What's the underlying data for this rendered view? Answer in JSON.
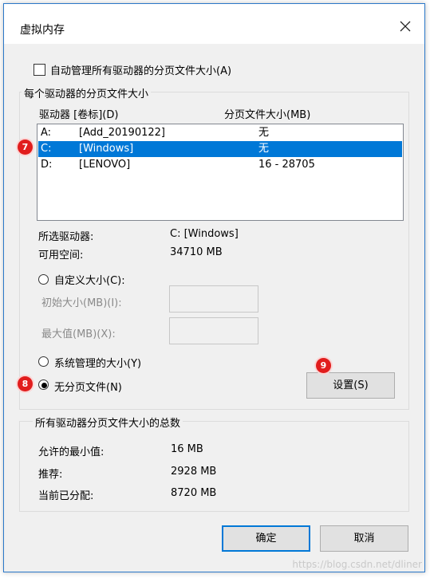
{
  "window": {
    "title": "虚拟内存",
    "close_icon": "close-icon"
  },
  "auto_manage": {
    "label": "自动管理所有驱动器的分页文件大小(A)",
    "checked": false
  },
  "per_drive": {
    "group_title": "每个驱动器的分页文件大小",
    "col_drive": "驱动器 [卷标](D)",
    "col_size": "分页文件大小(MB)",
    "drives": [
      {
        "letter": "A:",
        "label": "[Add_20190122]",
        "size": "无",
        "selected": false
      },
      {
        "letter": "C:",
        "label": "[Windows]",
        "size": "无",
        "selected": true
      },
      {
        "letter": "D:",
        "label": "[LENOVO]",
        "size": "16 - 28705",
        "selected": false
      }
    ],
    "selected_drive_label": "所选驱动器:",
    "selected_drive_value": "C:  [Windows]",
    "free_space_label": "可用空间:",
    "free_space_value": "34710 MB",
    "custom_size_label": "自定义大小(C):",
    "initial_size_label": "初始大小(MB)(I):",
    "max_size_label": "最大值(MB)(X):",
    "system_managed_label": "系统管理的大小(Y)",
    "no_paging_label": "无分页文件(N)",
    "set_button": "设置(S)"
  },
  "totals": {
    "group_title": "所有驱动器分页文件大小的总数",
    "min_label": "允许的最小值:",
    "min_value": "16 MB",
    "recommended_label": "推荐:",
    "recommended_value": "2928 MB",
    "allocated_label": "当前已分配:",
    "allocated_value": "8720 MB"
  },
  "buttons": {
    "ok": "确定",
    "cancel": "取消"
  },
  "annotations": {
    "badge7": "7",
    "badge8": "8",
    "badge9": "9"
  },
  "watermark": "https://blog.csdn.net/dliner",
  "colors": {
    "selection": "#0078d7",
    "badge": "#e11d1d",
    "border_accent": "#2b78c9"
  }
}
